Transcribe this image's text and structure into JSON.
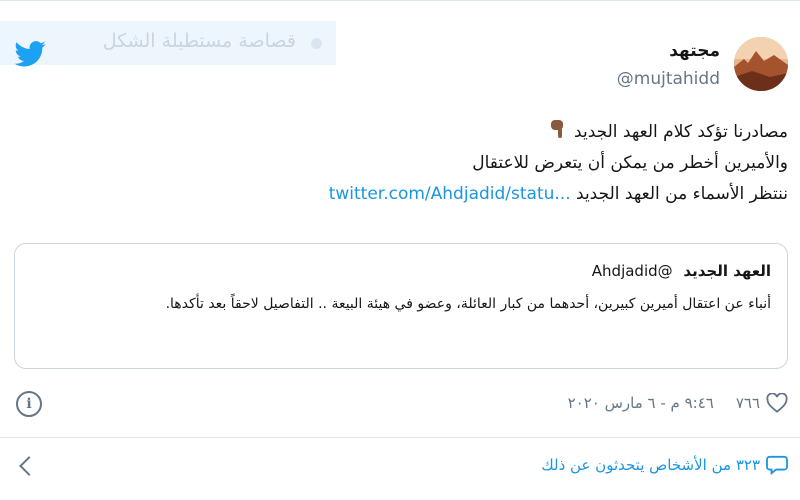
{
  "user": {
    "name": "مجتهد",
    "handle": "@mujtahidd"
  },
  "banner": {
    "text": "قصاصة مستطيلة الشكل"
  },
  "tweet": {
    "line1": "مصادرنا تؤكد كلام العهد الجديد",
    "line2": "والأميرين أخطر من يمكن أن يتعرض للاعتقال",
    "line3_text": "ننتظر الأسماء من العهد الجديد",
    "line3_link": "twitter.com/Ahdjadid/statu..."
  },
  "quote": {
    "name": "العهد الجديد",
    "handle": "@Ahdjadid",
    "body": "أنباء عن اعتقال أميرين كبيرين، أحدهما من كبار العائلة، وعضو في هيئة البيعة .. التفاصيل لاحقاً بعد تأكدها."
  },
  "meta": {
    "likes": "٧٦٦",
    "timestamp": "٩:٤٦ م - ٦ مارس ٢٠٢٠"
  },
  "footer": {
    "talking": "٣٢٣ من الأشخاص يتحدثون عن ذلك"
  },
  "colors": {
    "link": "#1b95e0",
    "secondary": "#657786",
    "border": "#ccd6dd"
  },
  "icons": [
    "twitter-bird-icon",
    "pointing-hand-icon",
    "heart-icon",
    "info-icon",
    "reply-bubble-icon",
    "chevron-left-icon"
  ]
}
